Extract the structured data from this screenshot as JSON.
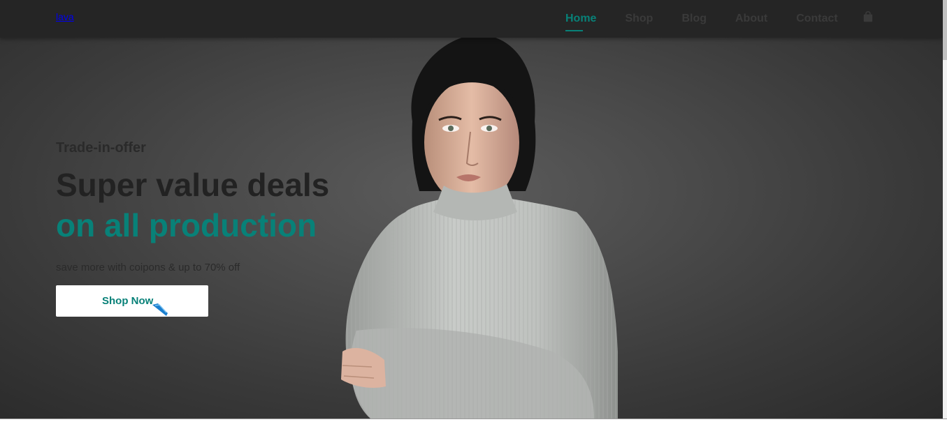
{
  "header": {
    "logo_text": "lava",
    "nav": [
      {
        "label": "Home",
        "active": true
      },
      {
        "label": "Shop",
        "active": false
      },
      {
        "label": "Blog",
        "active": false
      },
      {
        "label": "About",
        "active": false
      },
      {
        "label": "Contact",
        "active": false
      }
    ],
    "cart_icon": "shopping-bag-icon"
  },
  "hero": {
    "eyebrow": "Trade-in-offer",
    "headline_line1": "Super value deals",
    "headline_line2": "on all production",
    "subtext": "save more with coipons & up to 70% off",
    "cta_label": "Shop Now",
    "image": "woman-in-grey-sweater-photo"
  },
  "colors": {
    "accent": "#088178",
    "header_bg": "#252525",
    "hero_bg": "#4a4a4a",
    "button_bg": "#ffffff"
  }
}
